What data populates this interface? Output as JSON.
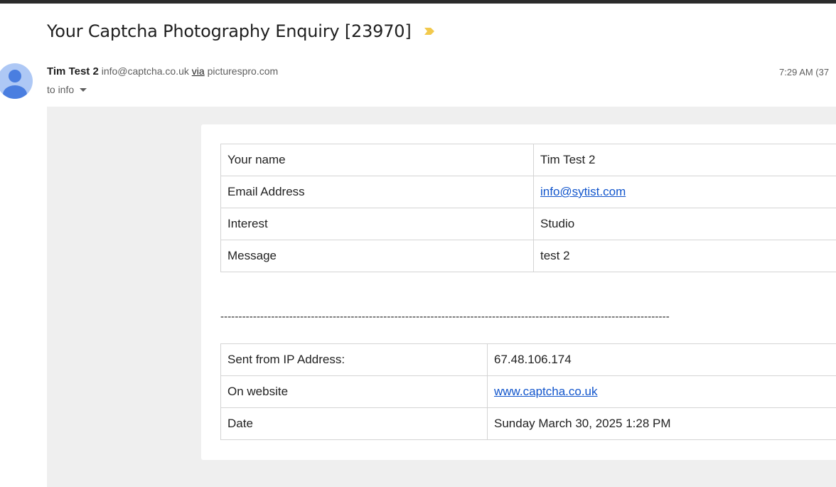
{
  "email": {
    "subject": "Your Captcha Photography Enquiry [23970]",
    "sender": {
      "name": "Tim Test 2",
      "address": "info@captcha.co.uk",
      "via_label": "via",
      "via_domain": "picturespro.com"
    },
    "timestamp": "7:29 AM (37",
    "recipient": "to info"
  },
  "icons": {
    "important": "important-marker-icon",
    "avatar": "person-avatar-icon",
    "recipient_menu": "chevron-down-icon"
  },
  "colors": {
    "important_marker": "#f2c94c",
    "avatar_bg": "#aec8f5",
    "avatar_figure": "#4a7ee0",
    "link": "#1155cc"
  },
  "enquiry_table": [
    {
      "label": "Your name",
      "value": "Tim Test 2"
    },
    {
      "label": "Email Address",
      "value": "info@sytist.com"
    },
    {
      "label": "Interest",
      "value": "Studio"
    },
    {
      "label": "Message",
      "value": "test 2"
    }
  ],
  "separator": "----------------------------------------------------------------------------------------------------------------------------",
  "meta_table": [
    {
      "label": "Sent from IP Address:",
      "value": "67.48.106.174"
    },
    {
      "label": "On website",
      "value": "www.captcha.co.uk"
    },
    {
      "label": "Date",
      "value": "Sunday March 30, 2025 1:28 PM"
    }
  ]
}
